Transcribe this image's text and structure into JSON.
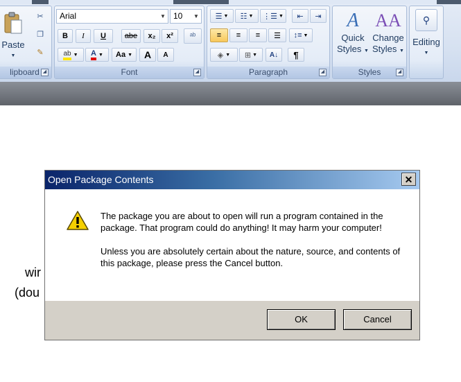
{
  "ribbon": {
    "clipboard": {
      "group_label": "lipboard",
      "paste_label": "Paste"
    },
    "font": {
      "group_label": "Font",
      "font_name": "Arial",
      "font_size": "10",
      "bold": "B",
      "italic": "I",
      "underline": "U",
      "strike": "abe",
      "subscript": "x₂",
      "superscript": "x²",
      "grow": "A",
      "shrink": "A",
      "change_case": "Aa",
      "font_color": "A"
    },
    "paragraph": {
      "group_label": "Paragraph",
      "pilcrow": "¶",
      "sort": "A↓"
    },
    "styles": {
      "group_label": "Styles",
      "quick_styles": [
        "Quick",
        "Styles"
      ],
      "change_styles": [
        "Change",
        "Styles"
      ]
    },
    "editing": {
      "label": "Editing"
    }
  },
  "document": {
    "line1": "wir",
    "line2": "(dou"
  },
  "dialog": {
    "title": "Open Package Contents",
    "close_glyph": "✕",
    "message_1": "The package you are about to open will run a program contained in the package. That program could do anything!  It may harm your computer!",
    "message_2": "Unless you are absolutely certain about the nature, source, and contents of this package, please press the Cancel button.",
    "ok_label": "OK",
    "cancel_label": "Cancel"
  }
}
